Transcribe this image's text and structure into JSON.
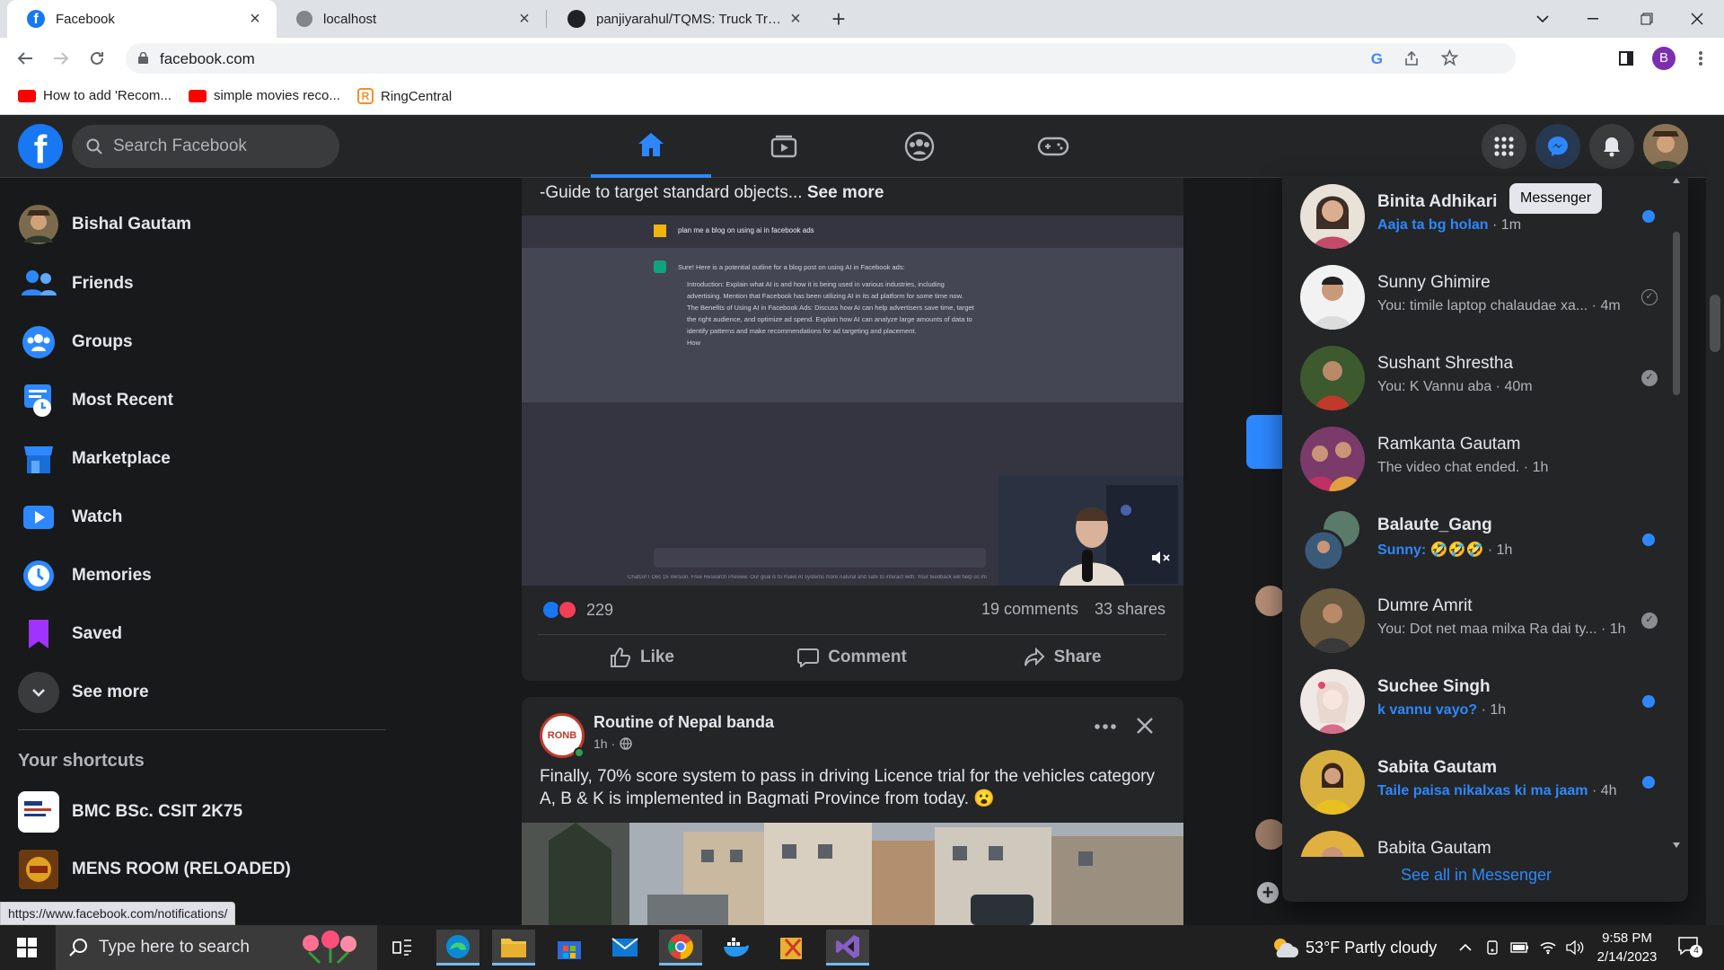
{
  "browser": {
    "tabs": [
      {
        "title": "Facebook",
        "active": true
      },
      {
        "title": "localhost",
        "active": false
      },
      {
        "title": "panjiyarahul/TQMS: Truck Trackin",
        "active": false
      }
    ],
    "url": "facebook.com",
    "profile_initial": "B",
    "bookmarks": [
      "How to add 'Recom...",
      "simple movies reco...",
      "RingCentral"
    ],
    "status_url": "https://www.facebook.com/notifications/"
  },
  "fb": {
    "search_placeholder": "Search Facebook",
    "sidebar": {
      "user_name": "Bishal Gautam",
      "items": [
        "Friends",
        "Groups",
        "Most Recent",
        "Marketplace",
        "Watch",
        "Memories",
        "Saved",
        "See more"
      ],
      "shortcuts_title": "Your shortcuts",
      "shortcuts": [
        "BMC BSc. CSIT 2K75",
        "MENS ROOM (RELOADED)"
      ]
    },
    "post1": {
      "text": "-Guide to target standard objects...",
      "see_more": "See more",
      "screenshot_prompt": "plan me a blog on using ai in facebook ads",
      "screenshot_answer_intro": "Sure! Here is a potential outline for a blog post on using AI in Facebook ads:",
      "screenshot_item1": "Introduction: Explain what AI is and how it is being used in various industries, including advertising. Mention that Facebook has been utilizing AI in its ad platform for some time now.",
      "screenshot_item2": "The Benefits of Using AI in Facebook Ads: Discuss how AI can help advertisers save time, target the right audience, and optimize ad spend. Explain how AI can analyze large amounts of data to identify patterns and make recommendations for ad targeting and placement.",
      "screenshot_item3": "How",
      "screenshot_footer": "ChatGPT Dec 15 Version. Free Research Preview. Our goal is to make AI systems more natural and safe to interact with. Your feedback will help us im",
      "reactions": "229",
      "comments": "19 comments",
      "shares": "33 shares",
      "like": "Like",
      "comment": "Comment",
      "share": "Share"
    },
    "post2": {
      "page_name": "Routine of Nepal banda",
      "avatar_text": "RONB",
      "time": "1h ·",
      "text": "Finally, 70% score system to pass in driving Licence trial for the vehicles category A, B & K is implemented in Bagmati Province from today. 😮"
    },
    "messenger": {
      "tooltip": "Messenger",
      "see_all": "See all in Messenger",
      "chats": [
        {
          "name": "Binita Adhikari",
          "preview": "Aaja ta bg holan",
          "time": " · 1m",
          "unread": true
        },
        {
          "name": "Sunny Ghimire",
          "preview": "You: timile laptop chalaudae xa...",
          "time": " · 4m",
          "unread": false
        },
        {
          "name": "Sushant Shrestha",
          "preview": "You: K Vannu aba",
          "time": " · 40m",
          "unread": false
        },
        {
          "name": "Ramkanta Gautam",
          "preview": "The video chat ended.",
          "time": " · 1h",
          "unread": false
        },
        {
          "name": "Balaute_Gang",
          "preview": "Sunny: 🤣🤣🤣",
          "time": " · 1h",
          "unread": true
        },
        {
          "name": "Dumre Amrit",
          "preview": "You: Dot net maa milxa Ra dai ty...",
          "time": " · 1h",
          "unread": false
        },
        {
          "name": "Suchee Singh",
          "preview": "k vannu vayo?",
          "time": " · 1h",
          "unread": true
        },
        {
          "name": "Sabita Gautam",
          "preview": "Taile paisa nikalxas ki ma jaam",
          "time": " · 4h",
          "unread": true
        },
        {
          "name": "Babita Gautam",
          "preview": "",
          "time": "",
          "unread": false
        }
      ]
    }
  },
  "taskbar": {
    "search_placeholder": "Type here to search",
    "weather": "53°F  Partly cloudy",
    "time": "9:58 PM",
    "date": "2/14/2023",
    "notif_count": "4"
  },
  "colors": {
    "fb_blue": "#1877f2",
    "accent": "#2d88ff",
    "bg": "#18191a",
    "surface": "#242526"
  }
}
